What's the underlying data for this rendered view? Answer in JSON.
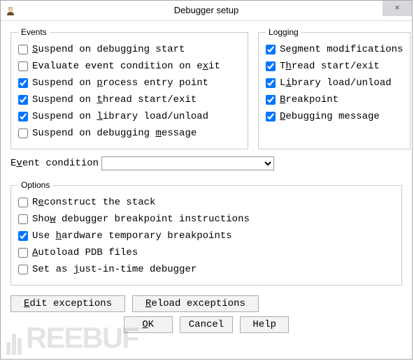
{
  "window": {
    "title": "Debugger setup",
    "close_glyph": "×"
  },
  "events": {
    "legend": "Events",
    "items": [
      {
        "checked": false,
        "pre": "",
        "u": "S",
        "post": "uspend on debugging start"
      },
      {
        "checked": false,
        "pre": "Evaluate event condition on e",
        "u": "x",
        "post": "it"
      },
      {
        "checked": true,
        "pre": "Suspend on ",
        "u": "p",
        "post": "rocess entry point"
      },
      {
        "checked": true,
        "pre": "Suspend on ",
        "u": "t",
        "post": "hread start/exit"
      },
      {
        "checked": true,
        "pre": "Suspend on ",
        "u": "l",
        "post": "ibrary load/unload"
      },
      {
        "checked": false,
        "pre": "Suspend on debugging ",
        "u": "m",
        "post": "essage"
      }
    ]
  },
  "logging": {
    "legend": "Logging",
    "items": [
      {
        "checked": true,
        "pre": "Se",
        "u": "g",
        "post": "ment modifications"
      },
      {
        "checked": true,
        "pre": "T",
        "u": "h",
        "post": "read start/exit"
      },
      {
        "checked": true,
        "pre": "L",
        "u": "i",
        "post": "brary load/unload"
      },
      {
        "checked": true,
        "pre": "",
        "u": "B",
        "post": "reakpoint"
      },
      {
        "checked": true,
        "pre": "",
        "u": "D",
        "post": "ebugging message"
      }
    ]
  },
  "event_condition": {
    "label_pre": "E",
    "label_u": "v",
    "label_post": "ent condition",
    "value": ""
  },
  "options": {
    "legend": "Options",
    "items": [
      {
        "checked": false,
        "pre": "R",
        "u": "e",
        "post": "construct the stack"
      },
      {
        "checked": false,
        "pre": "Sho",
        "u": "w",
        "post": " debugger breakpoint instructions"
      },
      {
        "checked": true,
        "pre": "Use ",
        "u": "h",
        "post": "ardware temporary breakpoints"
      },
      {
        "checked": false,
        "pre": "",
        "u": "A",
        "post": "utoload PDB files"
      },
      {
        "checked": false,
        "pre": "Set as ",
        "u": "j",
        "post": "ust-in-time debugger"
      }
    ]
  },
  "buttons": {
    "edit_exceptions": {
      "pre": "",
      "u": "E",
      "post": "dit exceptions"
    },
    "reload_exceptions": {
      "pre": "",
      "u": "R",
      "post": "eload exceptions"
    },
    "ok": {
      "pre": "",
      "u": "O",
      "post": "K"
    },
    "cancel": "Cancel",
    "help": "Help"
  },
  "watermark": "REEBUF"
}
